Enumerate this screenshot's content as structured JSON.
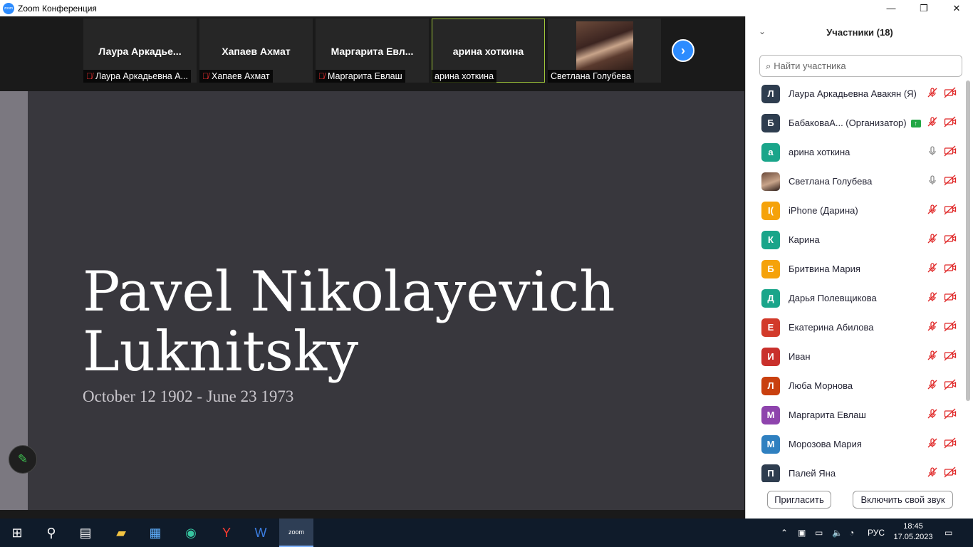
{
  "window": {
    "title": "Zoom Конференция",
    "app_icon_text": "zoom",
    "minimize": "—",
    "maximize": "❐",
    "close": "✕"
  },
  "gallery": {
    "tiles": [
      {
        "name": "Лаура  Аркадье...",
        "label": "Лаура Аркадьевна А...",
        "muted": true
      },
      {
        "name": "Хапаев Ахмат",
        "label": "Хапаев Ахмат",
        "muted": true
      },
      {
        "name": "Маргарита  Евл...",
        "label": "Маргарита Евлаш",
        "muted": true
      },
      {
        "name": "арина хоткина",
        "label": "арина хоткина",
        "muted": false,
        "active": true
      },
      {
        "name": "",
        "label": "Светлана Голубева",
        "muted": false,
        "photo": true
      }
    ],
    "next_icon": "›"
  },
  "slide": {
    "title_line1": "Pavel Nikolayevich",
    "title_line2": "Luknitsky",
    "dates": "October 12 1902 - June 23 1973",
    "annotate_icon": "✎"
  },
  "panel": {
    "title": "Участники (18)",
    "collapse_icon": "⌄",
    "search_placeholder": "Найти участника",
    "participants": [
      {
        "initial": "Л",
        "color": "#2e3d4f",
        "name": "Лаура Аркадьевна Авакян (Я)",
        "mic": "muted"
      },
      {
        "initial": "Б",
        "color": "#2e3d4f",
        "name": "БабаковаА...  (Организатор)",
        "mic": "muted",
        "badge": "↑"
      },
      {
        "initial": "а",
        "color": "#1aa58a",
        "name": "арина хоткина",
        "mic": "on"
      },
      {
        "initial": "",
        "color": "#5a3a2e",
        "name": "Светлана Голубева",
        "mic": "on",
        "photo": true
      },
      {
        "initial": "I(",
        "color": "#f5a20a",
        "name": "iPhone (Дарина)",
        "mic": "muted"
      },
      {
        "initial": "К",
        "color": "#1aa58a",
        "name": "Карина",
        "mic": "muted"
      },
      {
        "initial": "Б",
        "color": "#f5a20a",
        "name": "Бритвина Мария",
        "mic": "muted"
      },
      {
        "initial": "Д",
        "color": "#1aa58a",
        "name": "Дарья Полевщикова",
        "mic": "muted"
      },
      {
        "initial": "Е",
        "color": "#d23a2a",
        "name": "Екатерина Абилова",
        "mic": "muted"
      },
      {
        "initial": "И",
        "color": "#c9302c",
        "name": "Иван",
        "mic": "muted"
      },
      {
        "initial": "Л",
        "color": "#c9400f",
        "name": "Люба Морнова",
        "mic": "muted"
      },
      {
        "initial": "М",
        "color": "#8e44ad",
        "name": "Маргарита Евлаш",
        "mic": "muted"
      },
      {
        "initial": "М",
        "color": "#2f80c0",
        "name": "Морозова Мария",
        "mic": "muted"
      },
      {
        "initial": "П",
        "color": "#2e3d4f",
        "name": "Палей Яна",
        "mic": "muted"
      }
    ],
    "invite_label": "Пригласить",
    "unmute_label": "Включить свой звук"
  },
  "taskbar": {
    "lang": "РУС",
    "time": "18:45",
    "date": "17.05.2023"
  }
}
